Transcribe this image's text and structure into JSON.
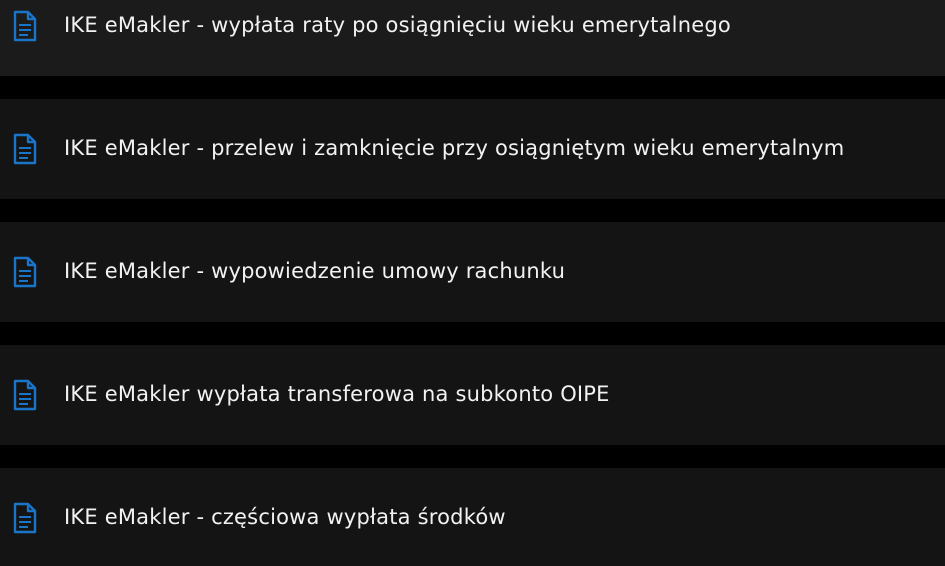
{
  "documents": {
    "icon": "document-icon",
    "accent_color": "#1a74c8",
    "items": [
      {
        "label": "IKE eMakler - wypłata raty po osiągnięciu wieku emerytalnego"
      },
      {
        "label": "IKE eMakler - przelew i zamknięcie przy osiągniętym wieku emerytalnym"
      },
      {
        "label": "IKE eMakler - wypowiedzenie umowy rachunku"
      },
      {
        "label": "IKE eMakler wypłata transferowa na subkonto OIPE"
      },
      {
        "label": "IKE eMakler - częściowa wypłata środków"
      }
    ]
  }
}
